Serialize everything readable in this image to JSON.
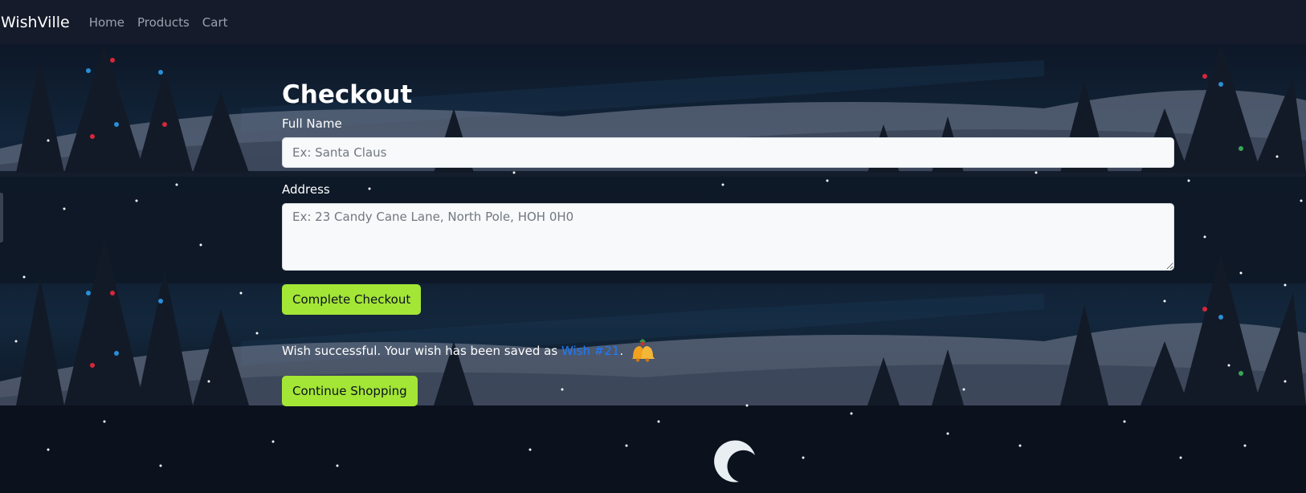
{
  "navbar": {
    "brand": "WishVille",
    "links": [
      "Home",
      "Products",
      "Cart"
    ]
  },
  "checkout": {
    "heading": "Checkout",
    "full_name_label": "Full Name",
    "full_name_placeholder": "Ex: Santa Claus",
    "address_label": "Address",
    "address_placeholder": "Ex: 23 Candy Cane Lane, North Pole, HOH 0H0",
    "submit_label": "Complete Checkout",
    "success_prefix": "Wish successful. Your wish has been saved as ",
    "wish_link": "Wish #21",
    "success_suffix": ".",
    "continue_label": "Continue Shopping"
  },
  "icons": {
    "bells": "bells-icon"
  },
  "colors": {
    "navbar_bg": "#161b2b",
    "accent_button": "#a3e635",
    "link": "#1e7bff"
  }
}
